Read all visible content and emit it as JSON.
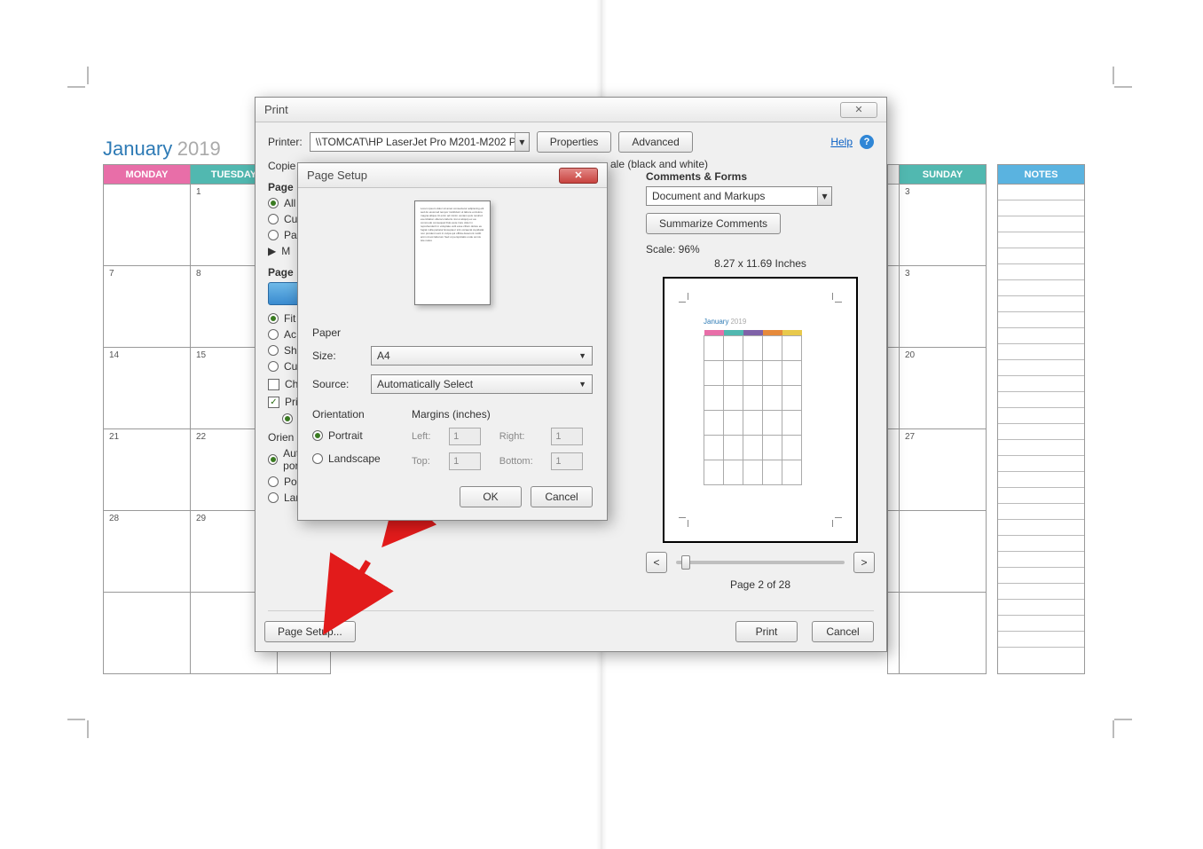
{
  "calendar": {
    "month": "January",
    "year": "2019",
    "days": {
      "monday": "MONDAY",
      "tuesday": "TUESDAY",
      "sunday": "SUNDAY",
      "notes": "NOTES"
    },
    "left_rows": [
      [
        " ",
        "1"
      ],
      [
        "7",
        "8"
      ],
      [
        "14",
        "15"
      ],
      [
        "21",
        "22"
      ],
      [
        "28",
        "29"
      ]
    ],
    "right_rows": [
      [
        "",
        "3"
      ],
      [
        "",
        "3"
      ],
      [
        "",
        "20"
      ],
      [
        "",
        "27"
      ],
      [
        "",
        ""
      ]
    ]
  },
  "printDialog": {
    "title": "Print",
    "printer_label": "Printer:",
    "printer_value": "\\\\TOMCAT\\HP LaserJet Pro M201-M202 P(",
    "properties_btn": "Properties",
    "advanced_btn": "Advanced",
    "help_label": "Help",
    "copies_label": "Copies",
    "grayscale_tail": "ale (black and white)",
    "pages_label": "Pages",
    "all_label": "All",
    "cu_label": "Cu",
    "pa_label": "Pa",
    "m_label": "M",
    "page_heading": "Page",
    "fit_label": "Fit",
    "ac_label": "Ac",
    "sh_label": "Sh",
    "cu2_label": "Cu",
    "ch_label": "Ch",
    "pri_label": "Pri",
    "orien_label": "Orien",
    "orient_auto": "Auto portrait/landscape",
    "orient_portrait": "Portrait",
    "orient_landscape": "Landscape",
    "page_setup_btn": "Page Setup...",
    "print_btn": "Print",
    "cancel_btn": "Cancel",
    "comments_forms": "Comments & Forms",
    "comments_dd": "Document and Markups",
    "summarize_btn": "Summarize Comments",
    "scale_label": "Scale:  96%",
    "paper_dims": "8.27 x 11.69 Inches",
    "page_of": "Page 2 of 28",
    "nav_prev": "<",
    "nav_next": ">"
  },
  "pageSetup": {
    "title": "Page Setup",
    "paper_legend": "Paper",
    "size_label": "Size:",
    "size_value": "A4",
    "source_label": "Source:",
    "source_value": "Automatically Select",
    "orient_legend": "Orientation",
    "orient_portrait": "Portrait",
    "orient_landscape": "Landscape",
    "margins_legend": "Margins (inches)",
    "left": "Left:",
    "right": "Right:",
    "top": "Top:",
    "bottom": "Bottom:",
    "margin_val": "1",
    "ok": "OK",
    "cancel": "Cancel"
  },
  "preview": {
    "mini_title": "January 2019"
  }
}
